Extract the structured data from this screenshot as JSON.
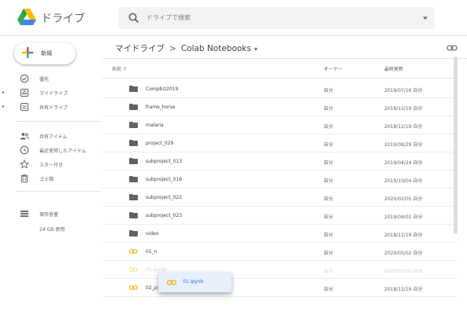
{
  "app": {
    "title": "ドライブ"
  },
  "search": {
    "placeholder": "ドライブで検索"
  },
  "new_button": {
    "label": "新規"
  },
  "sidebar": {
    "items": [
      {
        "label": "優先",
        "icon": "priority-check-icon"
      },
      {
        "label": "マイドライブ",
        "icon": "my-drive-icon"
      },
      {
        "label": "共有ドライブ",
        "icon": "shared-drives-icon"
      },
      {
        "label": "共有アイテム",
        "icon": "shared-with-me-icon"
      },
      {
        "label": "最近使用したアイテム",
        "icon": "recent-clock-icon"
      },
      {
        "label": "スター付き",
        "icon": "star-icon"
      },
      {
        "label": "ゴミ箱",
        "icon": "trash-icon"
      },
      {
        "label": "保存容量",
        "icon": "storage-icon"
      }
    ],
    "storage_used": "24 GB 使用"
  },
  "breadcrumb": {
    "root": "マイドライブ",
    "separator": ">",
    "current": "Colab Notebooks"
  },
  "table": {
    "headers": {
      "name": "名前",
      "owner": "オーナー",
      "modified": "最終更新"
    },
    "rows": [
      {
        "name": "Compbiz2019",
        "owner": "自分",
        "modified": "2019/07/16 自分",
        "type": "folder"
      },
      {
        "name": "frame_horse",
        "owner": "自分",
        "modified": "2018/12/19 自分",
        "type": "folder"
      },
      {
        "name": "malaria",
        "owner": "自分",
        "modified": "2018/12/19 自分",
        "type": "folder"
      },
      {
        "name": "project_029",
        "owner": "自分",
        "modified": "2019/08/29 自分",
        "type": "folder"
      },
      {
        "name": "subproject_013",
        "owner": "自分",
        "modified": "2019/04/24 自分",
        "type": "folder"
      },
      {
        "name": "subproject_016",
        "owner": "自分",
        "modified": "2019/10/04 自分",
        "type": "folder"
      },
      {
        "name": "subproject_022",
        "owner": "自分",
        "modified": "2020/02/05 自分",
        "type": "folder"
      },
      {
        "name": "subproject_023",
        "owner": "自分",
        "modified": "2019/04/02 自分",
        "type": "folder"
      },
      {
        "name": "video",
        "owner": "自分",
        "modified": "2018/12/19 自分",
        "type": "folder"
      },
      {
        "name": "01_n",
        "owner": "自分",
        "modified": "2020/05/02 自分",
        "type": "notebook"
      },
      {
        "name": "01.ipynb",
        "owner": "自分",
        "modified": "2020/05/02 自分",
        "type": "notebook-ghost"
      },
      {
        "name": "02_python.ipynb",
        "owner": "自分",
        "modified": "2018/12/19 自分",
        "type": "notebook"
      }
    ]
  },
  "drag": {
    "label": "01.ipynb"
  },
  "colors": {
    "folder": "#5f6368",
    "notebook": "#f9ab00",
    "accent": "#1a73e8",
    "drag_bg": "#e8f0fe"
  }
}
